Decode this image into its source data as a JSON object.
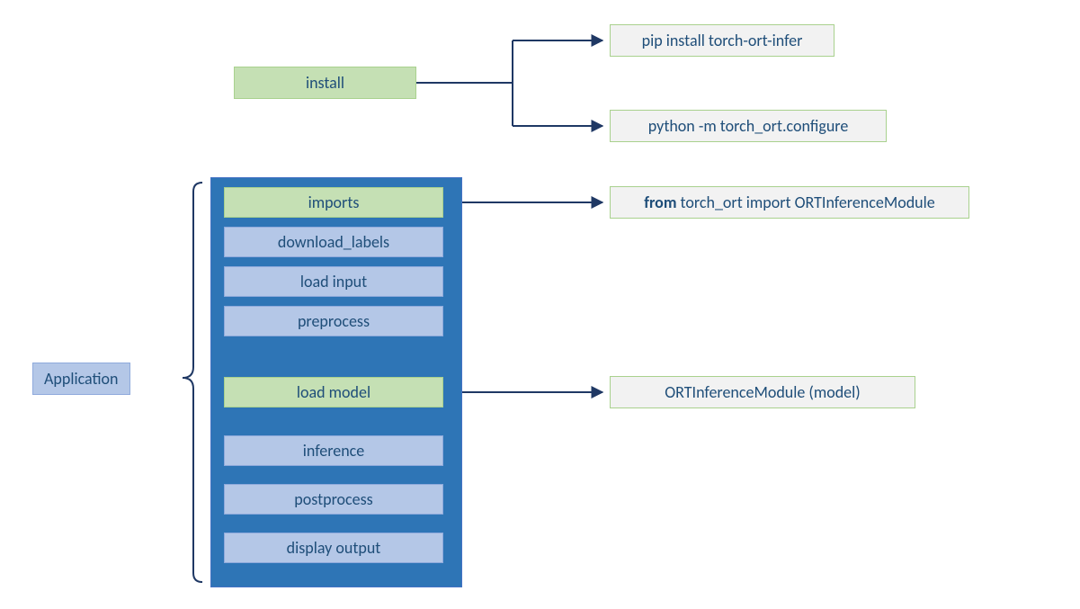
{
  "install": {
    "label": "install",
    "cmd1": "pip install torch-ort-infer",
    "cmd2": "python -m torch_ort.configure"
  },
  "application": {
    "label": "Application",
    "steps": {
      "imports": "imports",
      "download_labels": "download_labels",
      "load_input": "load input",
      "preprocess": "preprocess",
      "load_model": "load model",
      "inference": "inference",
      "postprocess": "postprocess",
      "display_output": "display output"
    }
  },
  "detail": {
    "imports_from": "from",
    "imports_rest": " torch_ort import ORTInferenceModule",
    "load_model": "ORTInferenceModule (model)"
  },
  "colors": {
    "green": "#c5e0b4",
    "blue_light": "#b4c7e7",
    "blue_dark": "#2e75b6",
    "gray": "#f2f2f2",
    "text": "#1f4e79",
    "line": "#1f3864"
  }
}
